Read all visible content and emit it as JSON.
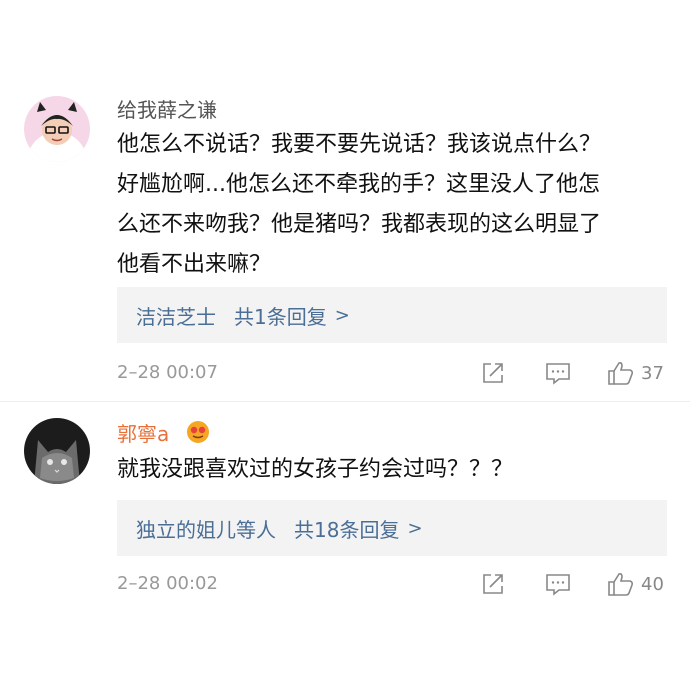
{
  "comments": [
    {
      "username": "给我薛之谦",
      "text_lines": [
        "他怎么不说话？我要不要先说话？我该说点什么？",
        "好尴尬啊...他怎么还不牵我的手？这里没人了他怎",
        "么还不来吻我？他是猪吗？我都表现的这么明显了",
        "他看不出来嘛？"
      ],
      "reply_user": "洁洁芝士",
      "reply_summary": "共1条回复",
      "reply_chevron": ">",
      "time": "2–28 00:07",
      "likes": "37"
    },
    {
      "username": "郭寧a",
      "text_lines": [
        "就我没跟喜欢过的女孩子约会过吗？？？"
      ],
      "reply_user": "独立的姐儿等人",
      "reply_summary": "共18条回复",
      "reply_chevron": ">",
      "time": "2–28 00:02",
      "likes": "40"
    }
  ],
  "colors": {
    "link": "#4a6e95",
    "username_vip": "#e8703a",
    "muted": "#999999",
    "reply_bg": "#f3f3f3"
  },
  "icons": {
    "share": "share-icon",
    "comment": "comment-icon",
    "like": "thumbs-up-icon",
    "badge": "vip-badge-icon"
  }
}
